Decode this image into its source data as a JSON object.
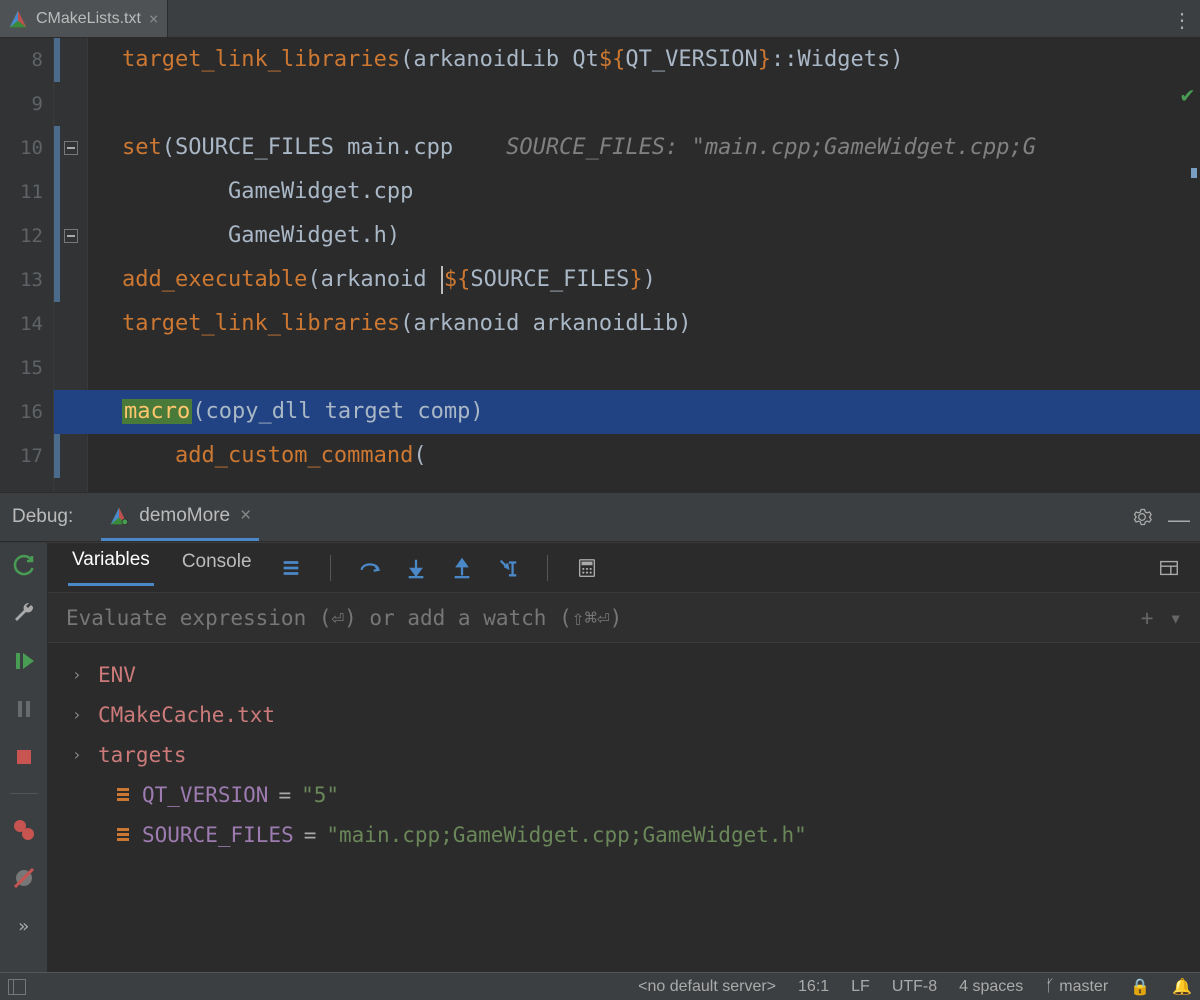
{
  "tabs": {
    "file": "CMakeLists.txt"
  },
  "editor": {
    "lines": [
      "8",
      "9",
      "10",
      "11",
      "12",
      "13",
      "14",
      "15",
      "16",
      "17"
    ],
    "l8": {
      "kw": "target_link_libraries",
      "p1": "(arkanoidLib Qt",
      "d": "${",
      "v": "QT_VERSION",
      "e": "}",
      "p2": "::Widgets)"
    },
    "l10": {
      "kw": "set",
      "args": "(SOURCE_FILES main.cpp",
      "hint": "SOURCE_FILES: \"main.cpp;GameWidget.cpp;G"
    },
    "l11": "        GameWidget.cpp",
    "l12": "        GameWidget.h)",
    "l13": {
      "kw": "add_executable",
      "p1": "(arkanoid ",
      "d": "${",
      "v": "SOURCE_FILES",
      "e": "}",
      "p2": ")"
    },
    "l14": {
      "kw": "target_link_libraries",
      "args": "(arkanoid arkanoidLib)"
    },
    "l16": {
      "kw": "macro",
      "args": "(copy_dll target comp)"
    },
    "l17": {
      "kw": "add_custom_command",
      "args": "("
    }
  },
  "debug": {
    "label": "Debug:",
    "config": "demoMore",
    "tabs": {
      "vars": "Variables",
      "console": "Console"
    },
    "eval_placeholder": "Evaluate expression (⏎) or add a watch (⇧⌘⏎)",
    "vars": [
      {
        "name": "ENV"
      },
      {
        "name": "CMakeCache.txt"
      },
      {
        "name": "targets"
      }
    ],
    "vals": [
      {
        "name": "QT_VERSION",
        "val": "\"5\""
      },
      {
        "name": "SOURCE_FILES",
        "val": "\"main.cpp;GameWidget.cpp;GameWidget.h\""
      }
    ]
  },
  "status": {
    "server": "<no default server>",
    "pos": "16:1",
    "eol": "LF",
    "enc": "UTF-8",
    "indent": "4 spaces",
    "branch": "master"
  }
}
